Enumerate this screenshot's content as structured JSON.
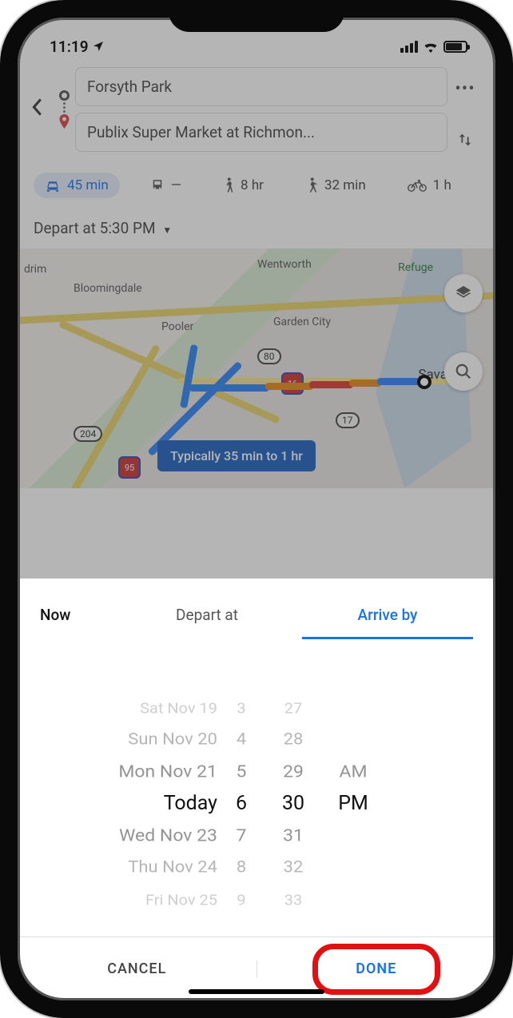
{
  "status": {
    "time": "11:19"
  },
  "routes": {
    "origin": "Forsyth Park",
    "destination": "Publix Super Market at Richmon..."
  },
  "modes": {
    "drive": "45 min",
    "transit": "—",
    "walk": "8 hr",
    "ride": "32 min",
    "bike": "1 h"
  },
  "depart_label": "Depart at 5:30 PM",
  "map": {
    "places": {
      "drim": "drim",
      "bloomingdale": "Bloomingdale",
      "pooler": "Pooler",
      "wentworth": "Wentworth",
      "garden_city": "Garden City",
      "refuge": "Refuge",
      "sava": "Sava"
    },
    "shields": {
      "us80": "80",
      "s204": "204",
      "i95": "95",
      "i16": "16",
      "s17": "17"
    },
    "tooltip": "Typically 35 min to 1 hr"
  },
  "sheet": {
    "tabs": {
      "now": "Now",
      "depart": "Depart at",
      "arrive": "Arrive by"
    },
    "picker": {
      "date": {
        "m3": "",
        "m2": "Sat Nov 19",
        "m1": "Sun Nov 20",
        "n1": "Mon Nov 21",
        "sel": "Today",
        "p1": "Wed Nov 23",
        "p2": "Thu Nov 24",
        "p3": "Fri Nov 25"
      },
      "hour": {
        "m3": "",
        "m2": "3",
        "m1": "4",
        "n1": "5",
        "sel": "6",
        "p1": "7",
        "p2": "8",
        "p3": "9"
      },
      "min": {
        "m3": "",
        "m2": "27",
        "m1": "28",
        "n1": "29",
        "sel": "30",
        "p1": "31",
        "p2": "32",
        "p3": "33"
      },
      "ap": {
        "n1": "AM",
        "sel": "PM"
      }
    },
    "cancel": "CANCEL",
    "done": "DONE"
  }
}
